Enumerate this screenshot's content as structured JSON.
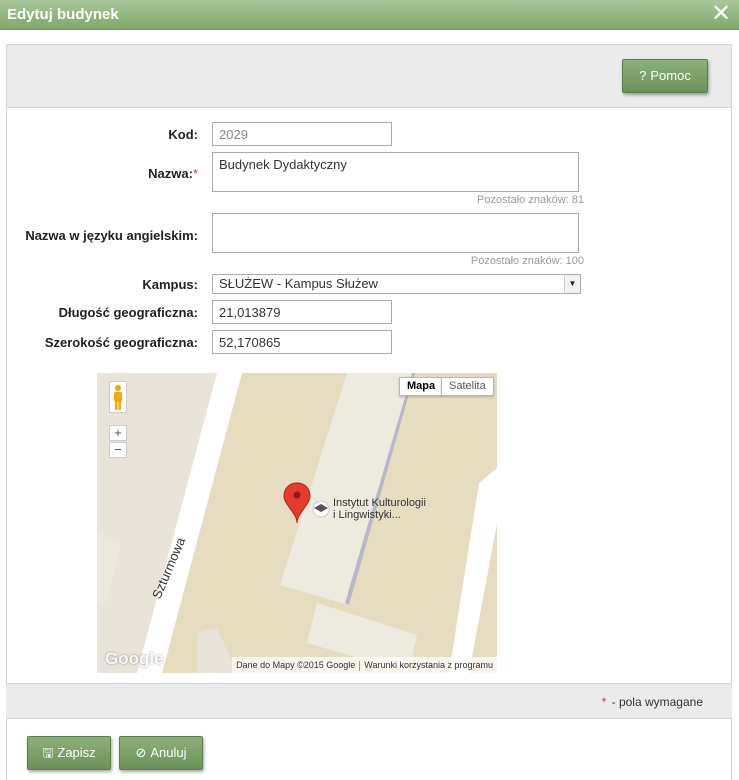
{
  "window": {
    "title": "Edytuj budynek",
    "close_icon": "close-icon"
  },
  "toolbar": {
    "help_label": "Pomoc",
    "help_icon": "question-icon"
  },
  "form": {
    "kod": {
      "label": "Kod:",
      "value": "2029"
    },
    "nazwa": {
      "label": "Nazwa:",
      "required_mark": "*",
      "value": "Budynek Dydaktyczny",
      "counter": "Pozostało znaków: 81"
    },
    "nazwa_en": {
      "label": "Nazwa w języku angielskim:",
      "value": "",
      "counter": "Pozostało znaków: 100"
    },
    "kampus": {
      "label": "Kampus:",
      "selected": "SŁUŻEW - Kampus Służew"
    },
    "dlugosc": {
      "label": "Długość geograficzna:",
      "value": "21,013879"
    },
    "szerokosc": {
      "label": "Szerokość geograficzna:",
      "value": "52,170865"
    }
  },
  "map": {
    "type_map": "Mapa",
    "type_satellite": "Satelita",
    "zoom_in": "+",
    "zoom_out": "−",
    "poi_label": "Instytut Kulturologii\ni Lingwistyki...",
    "street": "Szturmowa",
    "logo": "Google",
    "attribution_data": "Dane do Mapy ©2015 Google",
    "attribution_terms": "Warunki korzystania z programu",
    "colors": {
      "background": "#e6dcc0",
      "road": "#ffffff",
      "building": "#ede8dc",
      "marker": "#e53a2e"
    }
  },
  "footer": {
    "required_mark": "*",
    "required_note": " - pola wymagane",
    "save_label": "Zapisz",
    "save_icon": "floppy-icon",
    "cancel_label": "Anuluj",
    "cancel_icon": "cancel-icon"
  },
  "colors": {
    "accent": "#7ea86a",
    "required": "#dd3333"
  }
}
